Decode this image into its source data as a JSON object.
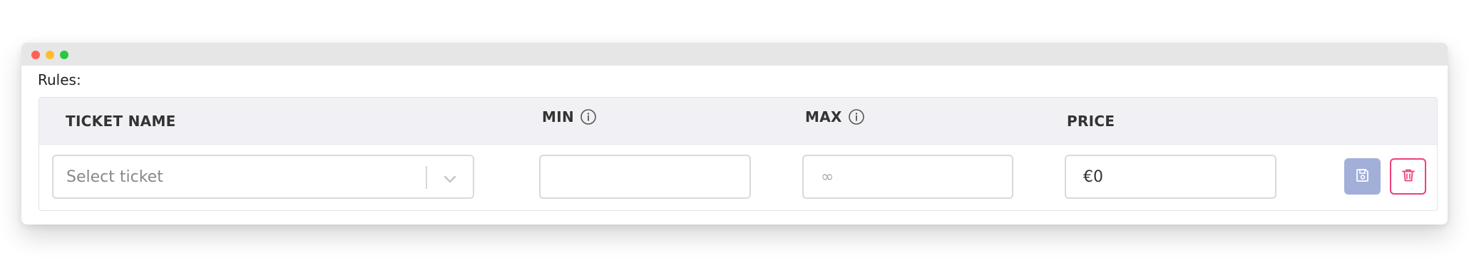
{
  "window": {
    "controls": [
      "close",
      "minimize",
      "maximize"
    ]
  },
  "rules": {
    "label": "Rules:"
  },
  "table": {
    "headers": {
      "ticket_name": "TICKET NAME",
      "min": "MIN",
      "max": "MAX",
      "price": "PRICE"
    },
    "header_icons": {
      "min": "info-circle-icon",
      "max": "info-circle-icon"
    },
    "row": {
      "ticket_select": {
        "placeholder": "Select ticket",
        "icon": "chevron-down-icon"
      },
      "min_input": {
        "value": "",
        "placeholder": ""
      },
      "max_input": {
        "value": "",
        "placeholder": "∞"
      },
      "price_input": {
        "value": "€0"
      },
      "actions": {
        "save_icon": "floppy-disk-icon",
        "delete_icon": "trash-icon"
      }
    }
  },
  "colors": {
    "save_button": "#a2b0d9",
    "delete_border": "#ef3e7a",
    "header_bg": "#f1f1f5"
  }
}
